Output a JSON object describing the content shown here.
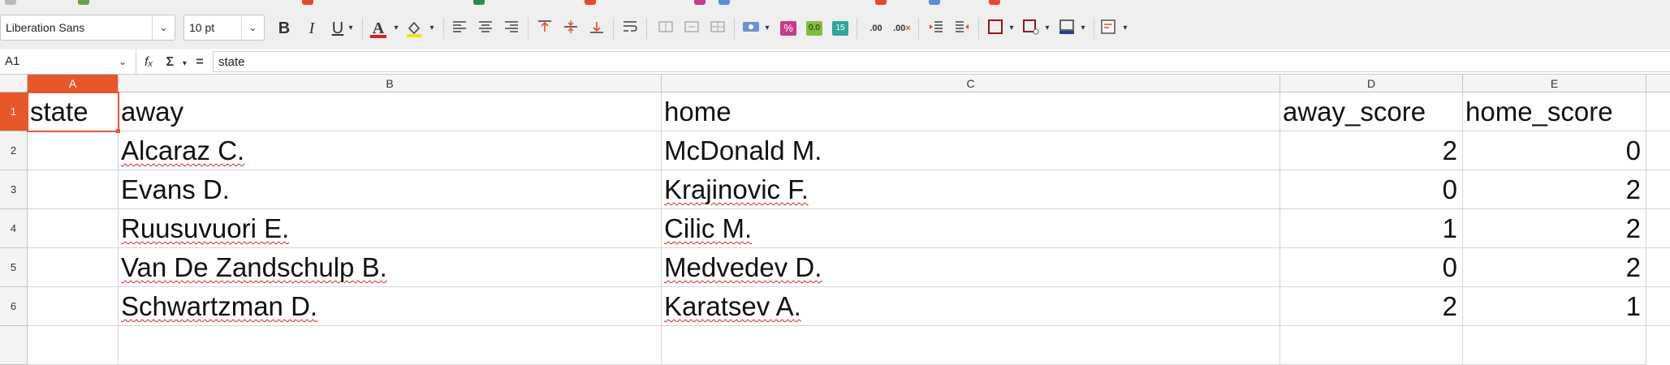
{
  "toolbar": {
    "font_name": "Liberation Sans",
    "font_size": "10 pt",
    "bold_label": "B",
    "italic_label": "I",
    "underline_label": "U",
    "font_color_label": "A"
  },
  "formula_bar": {
    "cell_ref": "A1",
    "fx_label": "fₓ",
    "sum_label": "Σ",
    "equals_label": "=",
    "content": "state"
  },
  "columns": [
    "A",
    "B",
    "C",
    "D",
    "E"
  ],
  "rows": [
    "1",
    "2",
    "3",
    "4",
    "5",
    "6"
  ],
  "header_row": [
    "state",
    "away",
    "home",
    "away_score",
    "home_score"
  ],
  "data_rows": [
    {
      "state": "",
      "away": "Alcaraz C.",
      "home": "McDonald M.",
      "away_score": "2",
      "home_score": "0"
    },
    {
      "state": "",
      "away": "Evans D.",
      "home": "Krajinovic F.",
      "away_score": "0",
      "home_score": "2"
    },
    {
      "state": "",
      "away": "Ruusuvuori E.",
      "home": "Cilic M.",
      "away_score": "1",
      "home_score": "2"
    },
    {
      "state": "",
      "away": "Van De Zandschulp B.",
      "home": "Medvedev D.",
      "away_score": "0",
      "home_score": "2"
    },
    {
      "state": "",
      "away": "Schwartzman D.",
      "home": "Karatsev A.",
      "away_score": "2",
      "home_score": "1"
    }
  ],
  "colors": {
    "selection_accent": "#e8572a",
    "spellcheck_underline": "#e0201b"
  }
}
